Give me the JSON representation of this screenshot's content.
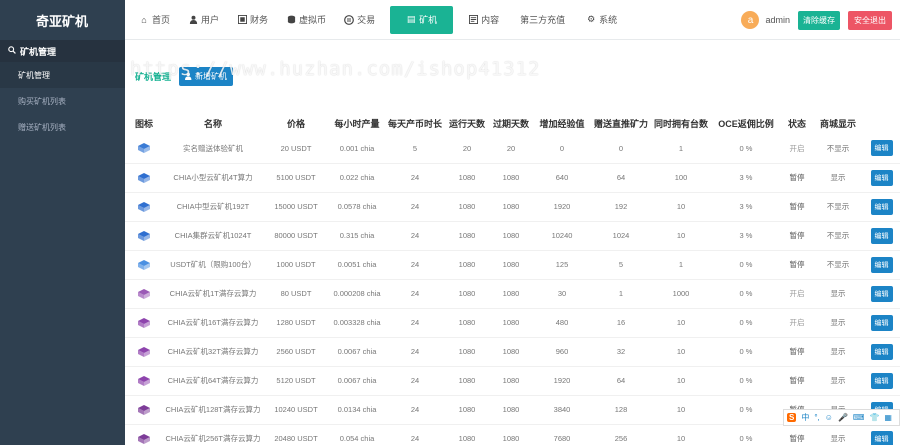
{
  "brand": {
    "title": "奇亚矿机"
  },
  "watermark": "https://www.huzhan.com/ishop41312",
  "topnav": {
    "items": [
      {
        "label": "首页",
        "icon": "home-icon"
      },
      {
        "label": "用户",
        "icon": "user-icon"
      },
      {
        "label": "财务",
        "icon": "finance-icon"
      },
      {
        "label": "虚拟币",
        "icon": "coins-icon"
      },
      {
        "label": "交易",
        "icon": "exchange-icon"
      },
      {
        "label": "矿机",
        "icon": "miner-icon",
        "active": true
      },
      {
        "label": "内容",
        "icon": "content-icon"
      },
      {
        "label": "第三方充值",
        "icon": ""
      },
      {
        "label": "系统",
        "icon": "gear-icon"
      }
    ],
    "user": {
      "avatar_letter": "a",
      "name": "admin"
    },
    "clear_cache_label": "清除缓存",
    "logout_label": "安全退出"
  },
  "sidebar": {
    "head_label": "矿机管理",
    "items": [
      {
        "label": "矿机管理",
        "active": true
      },
      {
        "label": "购买矿机列表"
      },
      {
        "label": "赠送矿机列表"
      }
    ]
  },
  "page": {
    "title": "矿机管理",
    "add_button_label": "新增矿机"
  },
  "table": {
    "columns": [
      "图标",
      "名称",
      "价格",
      "每小时产量",
      "每天产币时长",
      "运行天数",
      "过期天数",
      "增加经验值",
      "赠送直推矿力",
      "同时拥有台数",
      "OCE返佣比例",
      "状态",
      "商城显示",
      ""
    ],
    "rows": [
      {
        "icon_color": "#3a7bd5",
        "name": "实名赠送体验矿机",
        "price": "20 USDT",
        "hourly": "0.001 chia",
        "daily": "5",
        "run_days": "20",
        "expire_days": "20",
        "exp": "0",
        "power": "0",
        "own": "1",
        "rebate": "0 %",
        "status": "开启",
        "shop": "不显示",
        "action": "编辑"
      },
      {
        "icon_color": "#2f6fd0",
        "name": "CHIA小型云矿机4T算力",
        "price": "5100 USDT",
        "hourly": "0.022 chia",
        "daily": "24",
        "run_days": "1080",
        "expire_days": "1080",
        "exp": "640",
        "power": "64",
        "own": "100",
        "rebate": "3 %",
        "status": "暂停",
        "shop": "显示",
        "action": "编辑"
      },
      {
        "icon_color": "#2f6fd0",
        "name": "CHIA中型云矿机192T",
        "price": "15000 USDT",
        "hourly": "0.0578 chia",
        "daily": "24",
        "run_days": "1080",
        "expire_days": "1080",
        "exp": "1920",
        "power": "192",
        "own": "10",
        "rebate": "3 %",
        "status": "暂停",
        "shop": "不显示",
        "action": "编辑"
      },
      {
        "icon_color": "#2f6fd0",
        "name": "CHIA集群云矿机1024T",
        "price": "80000 USDT",
        "hourly": "0.315 chia",
        "daily": "24",
        "run_days": "1080",
        "expire_days": "1080",
        "exp": "10240",
        "power": "1024",
        "own": "10",
        "rebate": "3 %",
        "status": "暂停",
        "shop": "不显示",
        "action": "编辑"
      },
      {
        "icon_color": "#4a90e2",
        "name": "USDT矿机（限购100台）",
        "price": "1000 USDT",
        "hourly": "0.0051 chia",
        "daily": "24",
        "run_days": "1080",
        "expire_days": "1080",
        "exp": "125",
        "power": "5",
        "own": "1",
        "rebate": "0 %",
        "status": "暂停",
        "shop": "不显示",
        "action": "编辑"
      },
      {
        "icon_color": "#9b59b6",
        "name": "CHIA云矿机1T满存云算力",
        "price": "80 USDT",
        "hourly": "0.000208 chia",
        "daily": "24",
        "run_days": "1080",
        "expire_days": "1080",
        "exp": "30",
        "power": "1",
        "own": "1000",
        "rebate": "0 %",
        "status": "开启",
        "shop": "显示",
        "action": "编辑"
      },
      {
        "icon_color": "#8e44ad",
        "name": "CHIA云矿机16T满存云算力",
        "price": "1280 USDT",
        "hourly": "0.003328 chia",
        "daily": "24",
        "run_days": "1080",
        "expire_days": "1080",
        "exp": "480",
        "power": "16",
        "own": "10",
        "rebate": "0 %",
        "status": "开启",
        "shop": "显示",
        "action": "编辑"
      },
      {
        "icon_color": "#8e44ad",
        "name": "CHIA云矿机32T满存云算力",
        "price": "2560 USDT",
        "hourly": "0.0067 chia",
        "daily": "24",
        "run_days": "1080",
        "expire_days": "1080",
        "exp": "960",
        "power": "32",
        "own": "10",
        "rebate": "0 %",
        "status": "暂停",
        "shop": "显示",
        "action": "编辑"
      },
      {
        "icon_color": "#8e44ad",
        "name": "CHIA云矿机64T满存云算力",
        "price": "5120 USDT",
        "hourly": "0.0067 chia",
        "daily": "24",
        "run_days": "1080",
        "expire_days": "1080",
        "exp": "1920",
        "power": "64",
        "own": "10",
        "rebate": "0 %",
        "status": "暂停",
        "shop": "显示",
        "action": "编辑"
      },
      {
        "icon_color": "#7d3c98",
        "name": "CHIA云矿机128T满存云算力",
        "price": "10240 USDT",
        "hourly": "0.0134 chia",
        "daily": "24",
        "run_days": "1080",
        "expire_days": "1080",
        "exp": "3840",
        "power": "128",
        "own": "10",
        "rebate": "0 %",
        "status": "暂停",
        "shop": "显示",
        "action": "编辑"
      },
      {
        "icon_color": "#7d3c98",
        "name": "CHIA云矿机256T满存云算力",
        "price": "20480 USDT",
        "hourly": "0.054 chia",
        "daily": "24",
        "run_days": "1080",
        "expire_days": "1080",
        "exp": "7680",
        "power": "256",
        "own": "10",
        "rebate": "0 %",
        "status": "暂停",
        "shop": "显示",
        "action": "编辑"
      }
    ]
  },
  "ime": {
    "logo": "S",
    "items": [
      "中",
      "°,",
      "☺",
      "🎤",
      "⌨",
      "👕",
      "▦"
    ]
  }
}
